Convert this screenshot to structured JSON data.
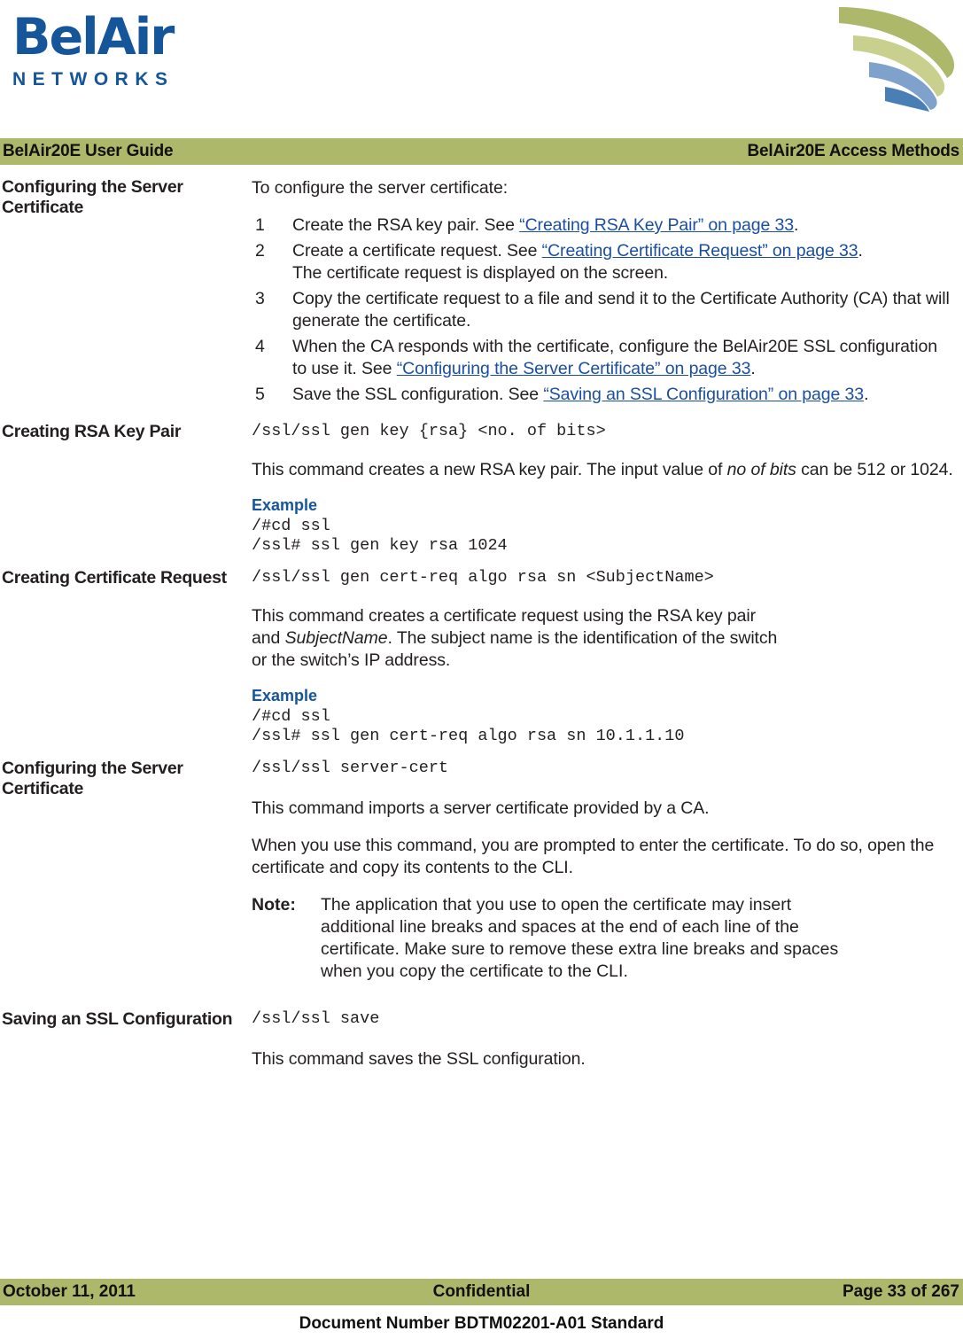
{
  "logo": {
    "wordmark": "BelAir",
    "subtitle": "NETWORKS",
    "brand_color": "#15559a"
  },
  "header": {
    "left": "BelAir20E User Guide",
    "right": "BelAir20E Access Methods",
    "bar_color": "#adb86a"
  },
  "sections": [
    {
      "heading": "Configuring the Server Certificate",
      "intro": "To configure the server certificate:",
      "steps": [
        {
          "num": "1",
          "pre": "Create the RSA key pair. See ",
          "link": "“Creating RSA Key Pair” on page 33",
          "post": "."
        },
        {
          "num": "2",
          "pre": "Create a certificate request. See ",
          "link": "“Creating Certificate Request” on page 33",
          "post": ".",
          "extra": "The certificate request is displayed on the screen."
        },
        {
          "num": "3",
          "pre": "Copy the certificate request to a file and send it to the Certificate Authority (CA) that will generate the certificate.",
          "link": "",
          "post": ""
        },
        {
          "num": "4",
          "pre": "When the CA responds with the certificate, configure the BelAir20E SSL configuration to use it. See ",
          "link": "“Configuring the Server Certificate” on page 33",
          "post": "."
        },
        {
          "num": "5",
          "pre": "Save the SSL configuration. See ",
          "link": "“Saving an SSL Configuration” on page 33",
          "post": "."
        }
      ]
    },
    {
      "heading": "Creating RSA Key Pair",
      "command": "/ssl/ssl gen key {rsa} <no. of bits>",
      "desc_a": "This command creates a new RSA key pair. The input value of ",
      "desc_ital": "no of bits",
      "desc_b": " can be 512 or 1024.",
      "example_label": "Example",
      "example_lines": "/#cd ssl\n/ssl# ssl gen key rsa 1024"
    },
    {
      "heading": "Creating Certificate Request",
      "command": "/ssl/ssl gen cert-req algo rsa sn <SubjectName>",
      "desc_a": "This command creates a certificate request using the RSA key pair and ",
      "desc_ital": "SubjectName",
      "desc_b": ". The subject name is the identification of the switch or the switch’s IP address.",
      "example_label": "Example",
      "example_lines": "/#cd ssl\n/ssl# ssl gen cert-req algo rsa sn 10.1.1.10"
    },
    {
      "heading": "Configuring the Server Certificate",
      "command": "/ssl/ssl server-cert",
      "para1": "This command imports a server certificate provided by a CA.",
      "para2": "When you use this command, you are prompted to enter the certificate. To do so, open the certificate and copy its contents to the CLI.",
      "note_label": "Note:",
      "note_text": "The application that you use to open the certificate may insert additional line breaks and spaces at the end of each line of the certificate. Make sure to remove these extra line breaks and spaces when you copy the certificate to the CLI."
    },
    {
      "heading": "Saving an SSL Configuration",
      "command": "/ssl/ssl save",
      "para1": "This command saves the SSL configuration."
    }
  ],
  "footer": {
    "left": "October 11, 2011",
    "center": "Confidential",
    "right": "Page 33 of 267",
    "doc_number": "Document Number BDTM02201-A01 Standard"
  }
}
